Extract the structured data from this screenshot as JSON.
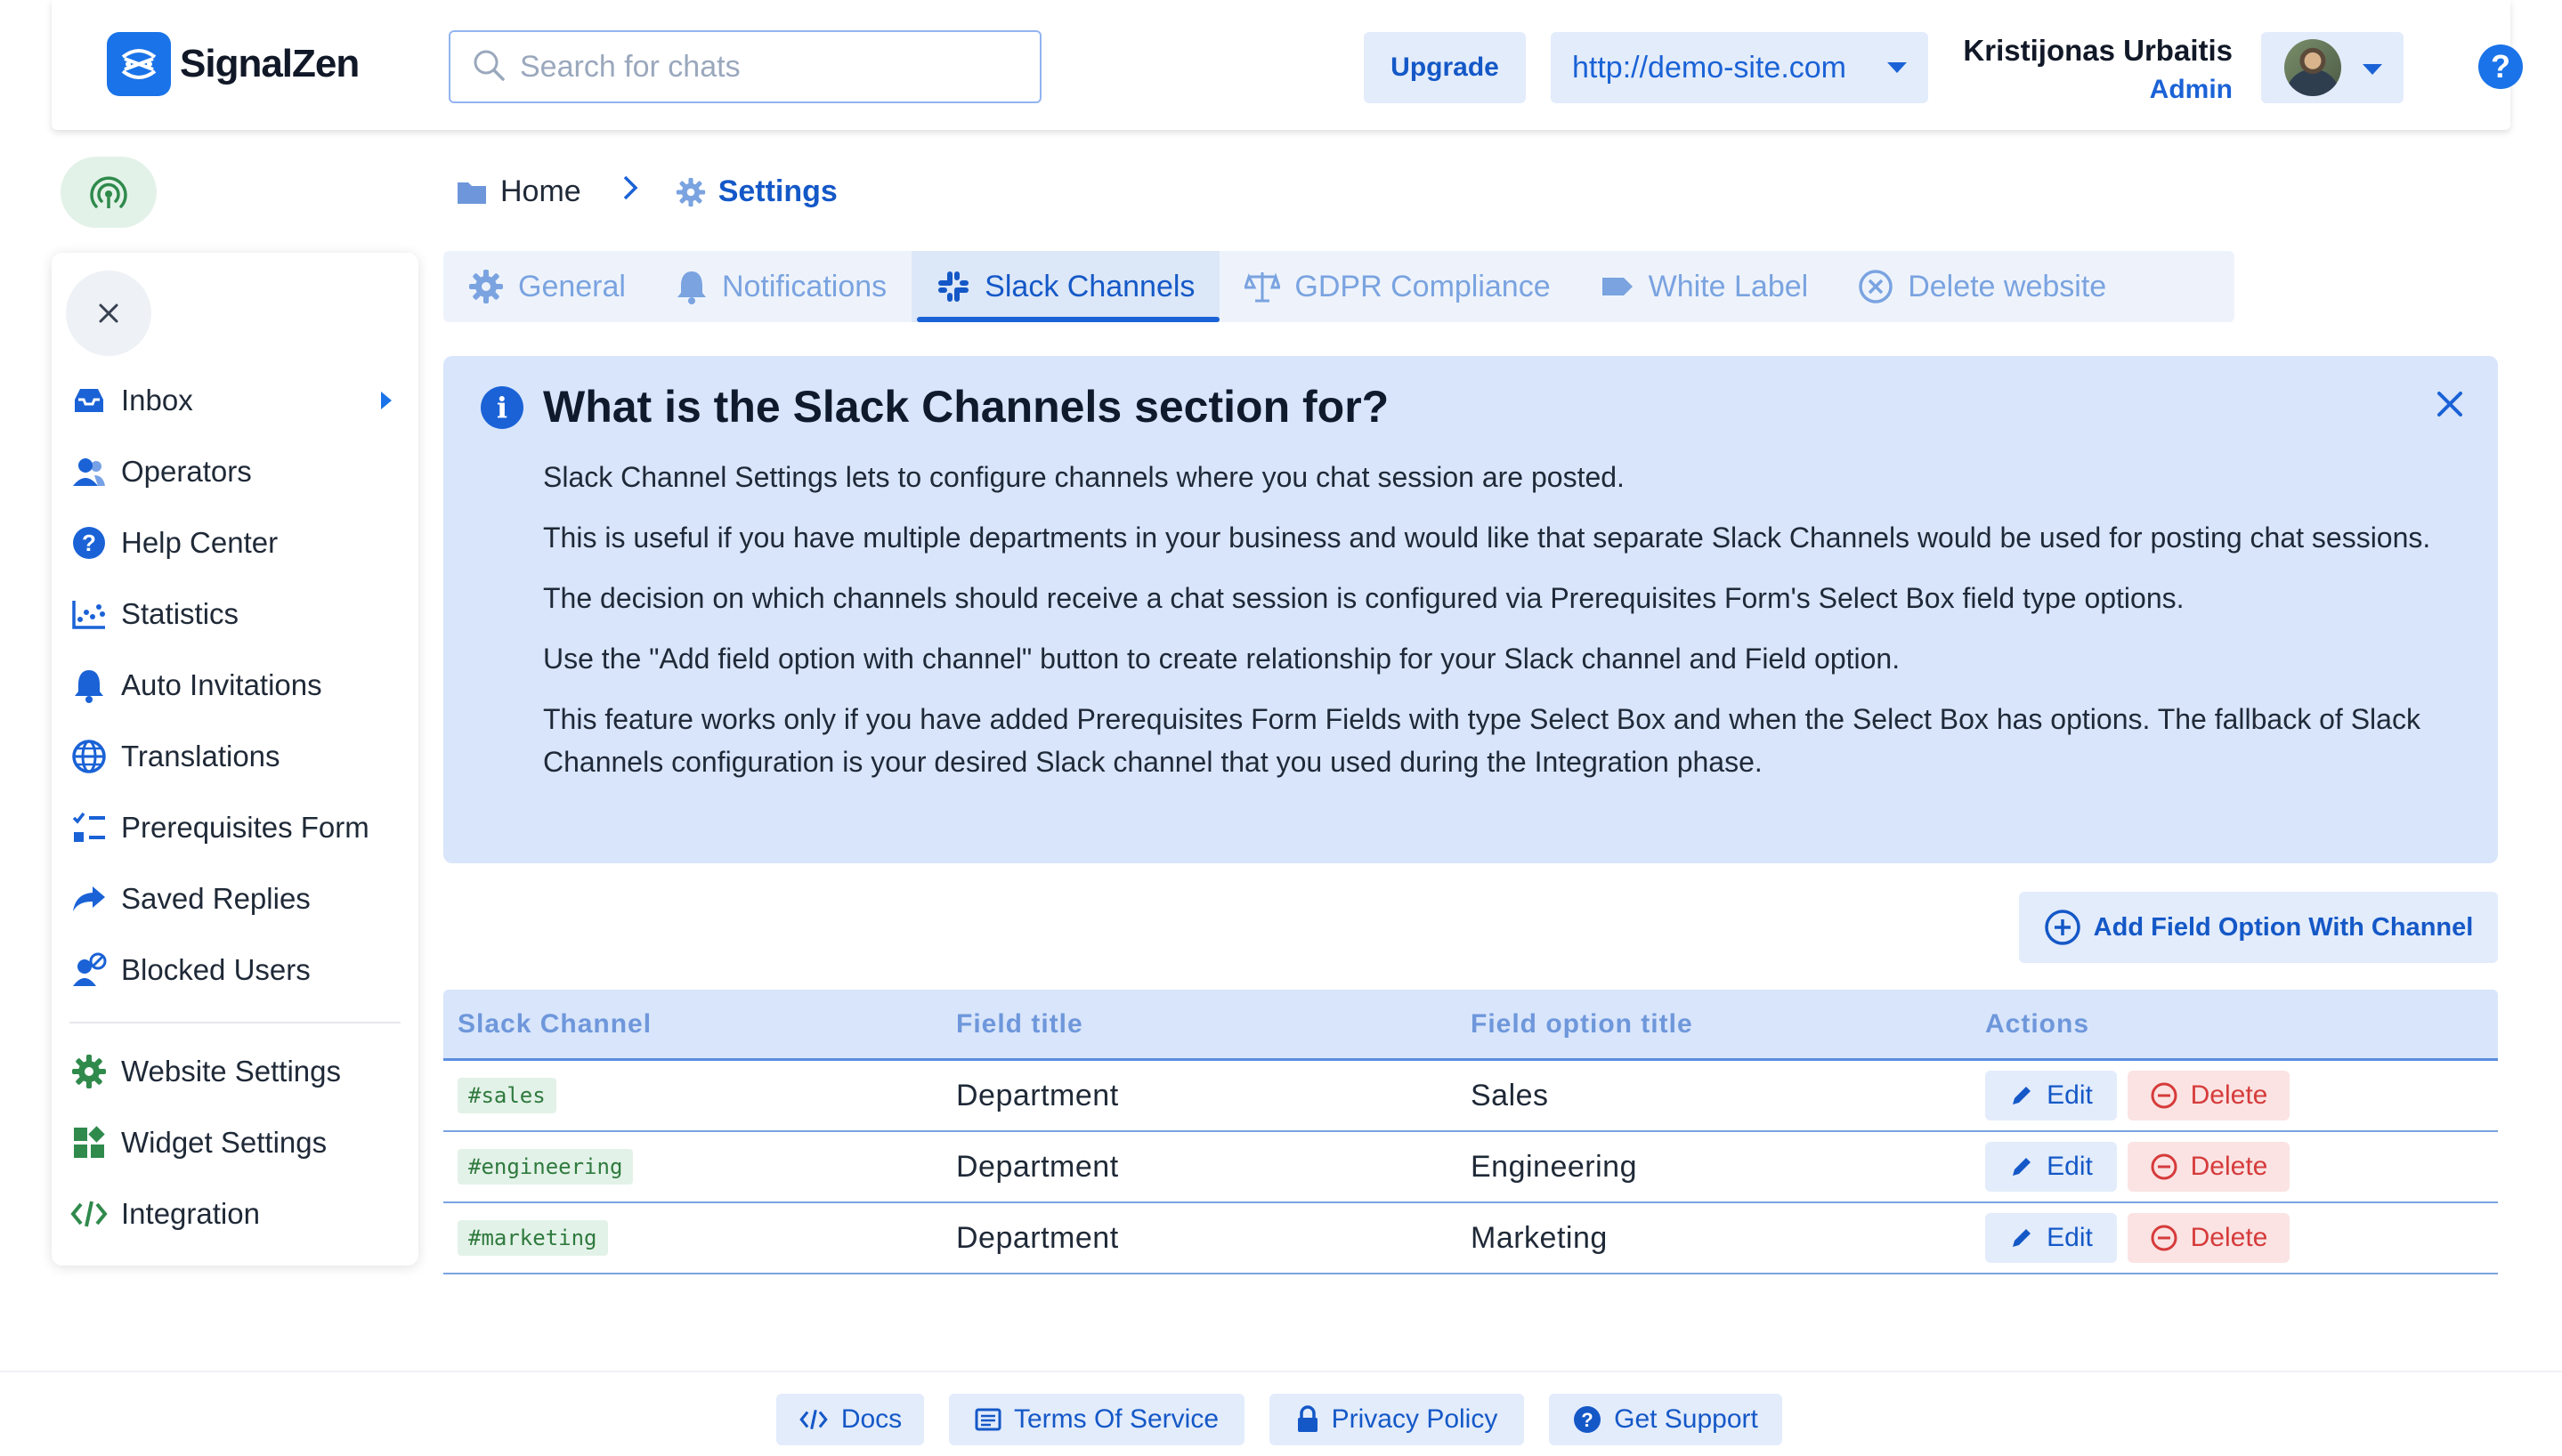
{
  "brand": {
    "name": "SignalZen",
    "accent": "#1a73e8"
  },
  "search": {
    "placeholder": "Search for chats",
    "value": ""
  },
  "header": {
    "upgrade_label": "Upgrade",
    "site_url": "http://demo-site.com",
    "user_name": "Kristijonas Urbaitis",
    "user_role": "Admin",
    "help_icon": "question-circle-icon"
  },
  "sidebar": {
    "items": [
      {
        "label": "Inbox",
        "icon": "inbox-icon"
      },
      {
        "label": "Operators",
        "icon": "users-icon"
      },
      {
        "label": "Help Center",
        "icon": "question-icon"
      },
      {
        "label": "Statistics",
        "icon": "chart-icon"
      },
      {
        "label": "Auto Invitations",
        "icon": "bell-icon"
      },
      {
        "label": "Translations",
        "icon": "globe-icon"
      },
      {
        "label": "Prerequisites Form",
        "icon": "checklist-icon"
      },
      {
        "label": "Saved Replies",
        "icon": "share-icon"
      },
      {
        "label": "Blocked Users",
        "icon": "user-block-icon"
      }
    ],
    "settings_items": [
      {
        "label": "Website Settings",
        "icon": "gear-icon"
      },
      {
        "label": "Widget Settings",
        "icon": "widgets-icon"
      },
      {
        "label": "Integration",
        "icon": "code-icon"
      }
    ]
  },
  "breadcrumb": {
    "home": "Home",
    "current": "Settings"
  },
  "tabs": [
    {
      "label": "General",
      "icon": "gear-icon"
    },
    {
      "label": "Notifications",
      "icon": "bell-icon"
    },
    {
      "label": "Slack Channels",
      "icon": "slack-icon",
      "active": true
    },
    {
      "label": "GDPR Compliance",
      "icon": "scale-icon"
    },
    {
      "label": "White Label",
      "icon": "tag-icon"
    },
    {
      "label": "Delete website",
      "icon": "x-circle-icon"
    }
  ],
  "info": {
    "title": "What is the Slack Channels section for?",
    "paragraphs": [
      "Slack Channel Settings lets to configure channels where you chat session are posted.",
      "This is useful if you have multiple departments in your business and would like that separate Slack Channels would be used for posting chat sessions.",
      "The decision on which channels should receive a chat session is configured via Prerequisites Form's Select Box field type options.",
      "Use the \"Add field option with channel\" button to create relationship for your Slack channel and Field option.",
      "This feature works only if you have added Prerequisites Form Fields with type Select Box and when the Select Box has options. The fallback of Slack Channels configuration is your desired Slack channel that you used during the Integration phase."
    ]
  },
  "add_button_label": "Add Field Option With Channel",
  "table": {
    "headers": [
      "Slack Channel",
      "Field title",
      "Field option title",
      "Actions"
    ],
    "rows": [
      {
        "channel": "#sales",
        "field": "Department",
        "option": "Sales"
      },
      {
        "channel": "#engineering",
        "field": "Department",
        "option": "Engineering"
      },
      {
        "channel": "#marketing",
        "field": "Department",
        "option": "Marketing"
      }
    ],
    "edit_label": "Edit",
    "delete_label": "Delete"
  },
  "footer": {
    "docs": "Docs",
    "terms": "Terms Of Service",
    "privacy": "Privacy Policy",
    "support": "Get Support"
  }
}
